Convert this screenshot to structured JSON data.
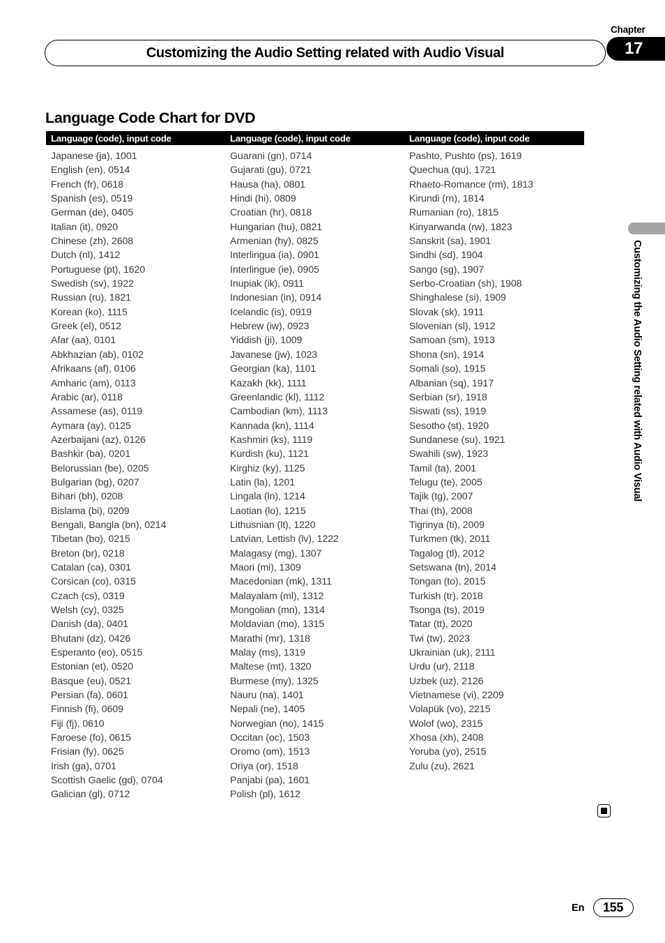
{
  "chapter": {
    "label": "Chapter",
    "number": "17"
  },
  "running_head": {
    "title": "Customizing the Audio Setting related with Audio Visual"
  },
  "side_tab": {
    "text": "Customizing the Audio Setting related with Audio Visual",
    "color": "#a5a5a5"
  },
  "section": {
    "heading": "Language Code Chart for DVD"
  },
  "table": {
    "headers": [
      "Language (code), input code",
      "Language (code), input code",
      "Language (code), input code"
    ],
    "columns": [
      [
        "Japanese (ja), 1001",
        "English (en), 0514",
        "French (fr), 0618",
        "Spanish (es), 0519",
        "German (de), 0405",
        "Italian (it), 0920",
        "Chinese (zh), 2608",
        "Dutch (nl), 1412",
        "Portuguese (pt), 1620",
        "Swedish (sv), 1922",
        "Russian (ru), 1821",
        "Korean (ko), 1115",
        "Greek (el), 0512",
        "Afar (aa), 0101",
        "Abkhazian (ab), 0102",
        "Afrikaans (af), 0106",
        "Amharic (am), 0113",
        "Arabic (ar), 0118",
        "Assamese (as), 0119",
        "Aymara (ay), 0125",
        "Azerbaijani (az), 0126",
        "Bashkir (ba), 0201",
        "Belorussian (be), 0205",
        "Bulgarian (bg), 0207",
        "Bihari (bh), 0208",
        "Bislama (bi), 0209",
        "Bengali, Bangla (bn), 0214",
        "Tibetan (bo), 0215",
        "Breton (br), 0218",
        "Catalan (ca), 0301",
        "Corsican (co), 0315",
        "Czach (cs), 0319",
        "Welsh (cy), 0325",
        "Danish (da), 0401",
        "Bhutani (dz), 0426",
        "Esperanto (eo), 0515",
        "Estonian (et), 0520",
        "Basque (eu), 0521",
        "Persian (fa), 0601",
        "Finnish (fi), 0609",
        "Fiji (fj), 0610",
        "Faroese (fo), 0615",
        "Frisian (fy), 0625",
        "Irish (ga), 0701",
        "Scottish Gaelic (gd), 0704",
        "Galician (gl), 0712"
      ],
      [
        "Guarani (gn), 0714",
        "Gujarati (gu), 0721",
        "Hausa (ha), 0801",
        "Hindi (hi), 0809",
        "Croatian (hr), 0818",
        "Hungarian (hu), 0821",
        "Armenian (hy), 0825",
        "Interlingua (ia), 0901",
        "Interlingue (ie), 0905",
        "Inupiak (ik), 0911",
        "Indonesian (in), 0914",
        "Icelandic (is), 0919",
        "Hebrew (iw), 0923",
        "Yiddish (ji), 1009",
        "Javanese (jw), 1023",
        "Georgian (ka), 1101",
        "Kazakh (kk), 1111",
        "Greenlandic (kl), 1112",
        "Cambodian (km), 1113",
        "Kannada (kn), 1114",
        "Kashmiri (ks), 1119",
        "Kurdish (ku), 1121",
        "Kirghiz (ky), 1125",
        "Latin (la), 1201",
        "Lingala (ln), 1214",
        "Laotian (lo), 1215",
        "Lithusnian (lt), 1220",
        "Latvian, Lettish (lv), 1222",
        "Malagasy (mg), 1307",
        "Maori (mi), 1309",
        "Macedonian (mk), 1311",
        "Malayalam (ml), 1312",
        "Mongolian (mn), 1314",
        "Moldavian (mo), 1315",
        "Marathi (mr), 1318",
        "Malay (ms), 1319",
        "Maltese (mt), 1320",
        "Burmese (my), 1325",
        "Nauru (na), 1401",
        "Nepali (ne), 1405",
        "Norwegian (no), 1415",
        "Occitan (oc), 1503",
        "Oromo (om), 1513",
        "Oriya (or), 1518",
        "Panjabi (pa), 1601",
        "Polish (pl), 1612"
      ],
      [
        "Pashto, Pushto (ps), 1619",
        "Quechua (qu), 1721",
        "Rhaeto-Romance (rm), 1813",
        "Kirundi (rn), 1814",
        "Rumanian (ro), 1815",
        "Kinyarwanda (rw), 1823",
        "Sanskrit (sa), 1901",
        "Sindhi (sd), 1904",
        "Sango (sg), 1907",
        "Serbo-Croatian (sh), 1908",
        "Shinghalese (si), 1909",
        "Slovak (sk), 1911",
        "Slovenian (sl), 1912",
        "Samoan (sm), 1913",
        "Shona (sn), 1914",
        "Somali (so), 1915",
        "Albanian (sq), 1917",
        "Serbian (sr), 1918",
        "Siswati (ss), 1919",
        "Sesotho (st), 1920",
        "Sundanese (su), 1921",
        "Swahili (sw), 1923",
        "Tamil (ta), 2001",
        "Telugu (te), 2005",
        "Tajik (tg), 2007",
        "Thai (th), 2008",
        "Tigrinya (ti), 2009",
        "Turkmen (tk), 2011",
        "Tagalog (tl), 2012",
        "Setswana (tn), 2014",
        "Tongan (to), 2015",
        "Turkish (tr), 2018",
        "Tsonga (ts), 2019",
        "Tatar (tt), 2020",
        "Twi (tw), 2023",
        "Ukrainian (uk), 2111",
        "Urdu (ur), 2118",
        "Uzbek (uz), 2126",
        "Vietnamese (vi), 2209",
        "Volapük (vo), 2215",
        "Wolof (wo), 2315",
        "Xhosa (xh), 2408",
        "Yoruba (yo), 2515",
        "Zulu (zu), 2621"
      ]
    ]
  },
  "end_marker": {
    "name": "end-of-section-square"
  },
  "footer": {
    "language": "En",
    "page_number": "155"
  }
}
